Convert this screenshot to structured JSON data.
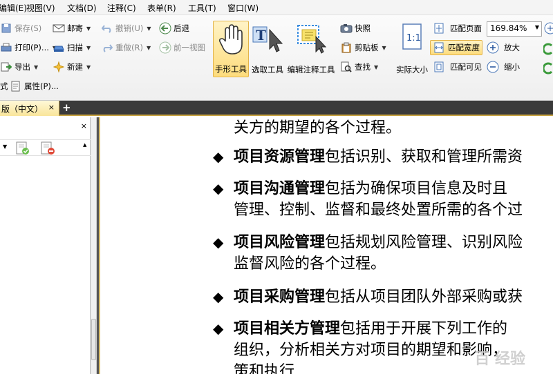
{
  "menubar": {
    "items": [
      "编辑(E)",
      "视图(V)",
      "文档(D)",
      "注释(C)",
      "表单(R)",
      "工具(T)",
      "窗口(W)"
    ]
  },
  "toolbar": {
    "save": "保存(S)",
    "mail": "邮寄",
    "undo": "撤销(U)",
    "back": "后退",
    "print": "打印(P)...",
    "scan": "扫描",
    "redo": "重做(R)",
    "prev_view": "前一视图",
    "export": "导出",
    "new": "新建",
    "format": "式",
    "properties": "属性(P)...",
    "hand_tool": "手形工具",
    "select_tool": "选取工具",
    "annot_tool": "编辑注释工具",
    "snapshot": "快照",
    "clipboard": "剪贴板",
    "find": "查找",
    "actual_size": "实际大小",
    "fit_page": "匹配页面",
    "fit_width": "匹配宽度",
    "fit_visible": "匹配可见",
    "zoom_value": "169.84%",
    "zoom_in": "放大",
    "zoom_out": "缩小"
  },
  "tabbar": {
    "doc_tab_label": "版（中文）",
    "close": "×",
    "add": "+"
  },
  "leftpanel": {
    "close": "×"
  },
  "document": {
    "lines": [
      {
        "text": "关方的期望的各个过程。"
      },
      {
        "bold": "项目资源管理",
        "text": "包括识别、获取和管理所需资"
      },
      {
        "bold": "项目沟通管理",
        "text": "包括为确保项目信息及时且"
      },
      {
        "text": "管理、控制、监督和最终处置所需的各个过"
      },
      {
        "bold": "项目风险管理",
        "text": "包括规划风险管理、识别风险"
      },
      {
        "text": "监督风险的各个过程。"
      },
      {
        "bold": "项目采购管理",
        "text": "包括从项目团队外部采购或获"
      },
      {
        "bold": "项目相关方管理",
        "text": "包括用于开展下列工作的"
      },
      {
        "text": "组织，分析相关方对项目的期望和影响，"
      },
      {
        "text": "策和执行"
      }
    ]
  },
  "watermark": "百 经验"
}
